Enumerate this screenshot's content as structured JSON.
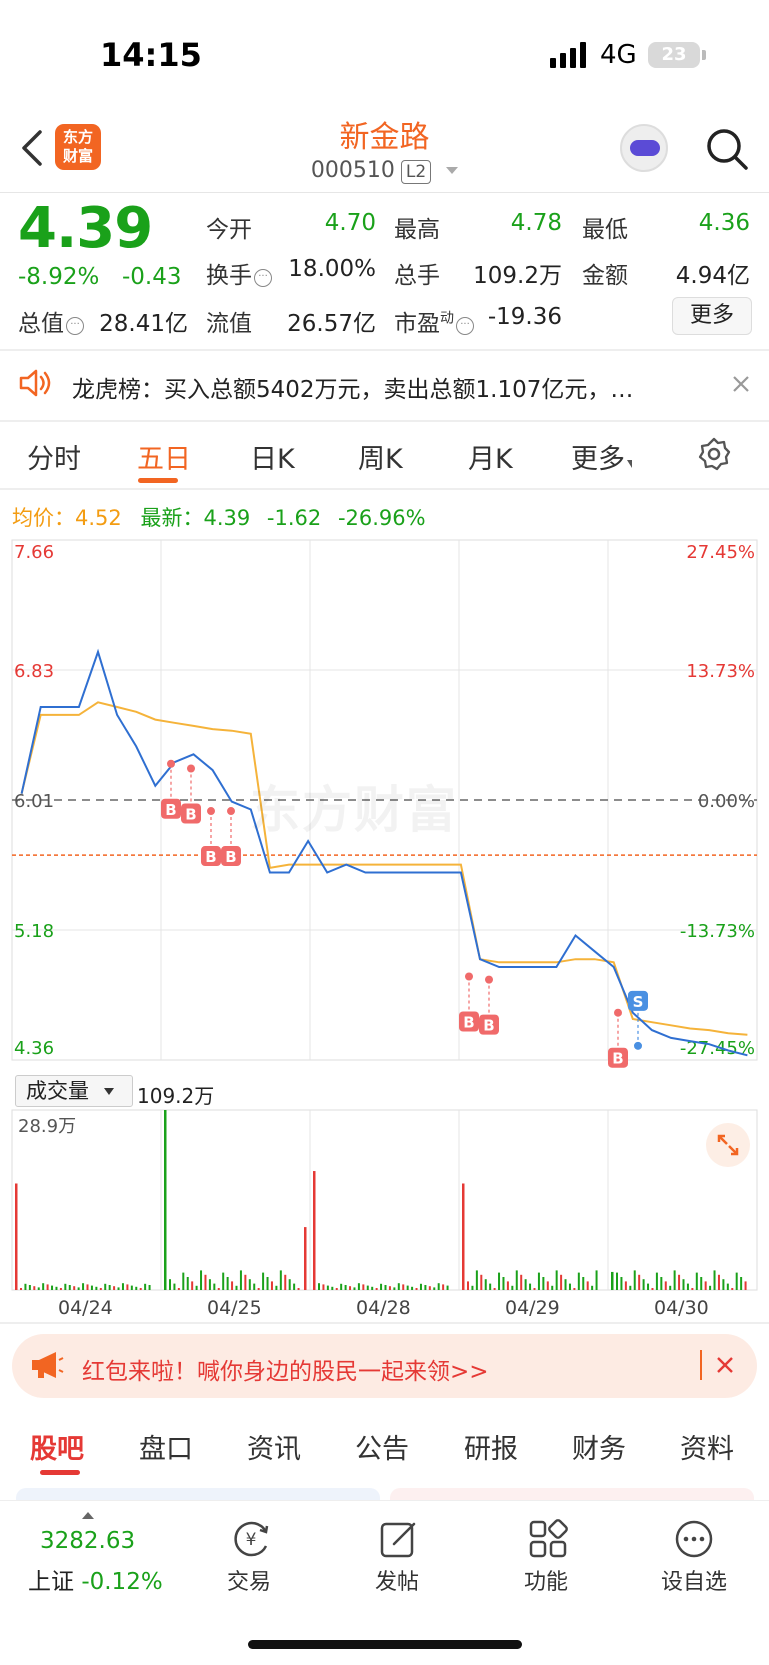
{
  "status_bar": {
    "time": "14:15",
    "network": "4G",
    "battery": "23"
  },
  "header": {
    "logo_line1": "东方",
    "logo_line2": "财富",
    "title": "新金路",
    "code": "000510",
    "level": "L2",
    "robot_icon": "robot-assistant-icon",
    "search_icon": "search-icon"
  },
  "quote": {
    "price": "4.39",
    "change_pct": "-8.92%",
    "change": "-0.43",
    "open_label": "今开",
    "open": "4.70",
    "high_label": "最高",
    "high": "4.78",
    "low_label": "最低",
    "low": "4.36",
    "turnover_label": "换手",
    "turnover": "18.00%",
    "volume_label": "总手",
    "volume": "109.2万",
    "amount_label": "金额",
    "amount": "4.94亿",
    "total_mv_label": "总值",
    "total_mv": "28.41亿",
    "float_mv_label": "流值",
    "float_mv": "26.57亿",
    "pe_label": "市盈",
    "pe_sup": "动",
    "pe": "-19.36",
    "more_label": "更多"
  },
  "news": {
    "text": "龙虎榜：买入总额5402万元，卖出总额1.107亿元，…"
  },
  "chart_tabs": [
    "分时",
    "五日",
    "日K",
    "周K",
    "月K",
    "更多"
  ],
  "chart_tab_active": 1,
  "summary": {
    "avg_label": "均价：",
    "avg_value": "4.52",
    "latest_label": "最新：",
    "latest_value": "4.39",
    "latest_change": "-1.62",
    "latest_pct": "-26.96%"
  },
  "volume_panel": {
    "label": "成交量",
    "total": "109.2万",
    "max": "28.9万"
  },
  "colors": {
    "up": "#e53935",
    "down": "#1aa11a",
    "price_line": "#2f6fd1",
    "avg_line": "#f5b33a",
    "brand": "#f26522"
  },
  "chart_data": {
    "type": "line",
    "x_labels": [
      "04/24",
      "04/25",
      "04/28",
      "04/29",
      "04/30"
    ],
    "y_left": [
      "7.66",
      "6.83",
      "6.01",
      "5.18",
      "4.36"
    ],
    "y_right": [
      "27.45%",
      "13.73%",
      "0.00%",
      "-13.73%",
      "-27.45%"
    ],
    "ylim": [
      4.36,
      7.66
    ],
    "prev_close": 6.01,
    "marker_line": 5.66,
    "series": [
      {
        "name": "均价",
        "values": [
          6.05,
          6.55,
          6.55,
          6.55,
          6.63,
          6.6,
          6.57,
          6.52,
          6.5,
          6.48,
          6.46,
          6.45,
          6.43,
          5.58,
          5.6,
          5.6,
          5.6,
          5.6,
          5.6,
          5.6,
          5.6,
          5.6,
          5.6,
          5.6,
          5.0,
          4.98,
          4.98,
          4.98,
          4.98,
          5.0,
          5.0,
          4.98,
          4.62,
          4.6,
          4.58,
          4.56,
          4.55,
          4.53,
          4.52
        ]
      },
      {
        "name": "最新",
        "values": [
          6.05,
          6.6,
          6.6,
          6.6,
          6.95,
          6.55,
          6.35,
          6.1,
          6.25,
          6.3,
          6.2,
          6.0,
          5.95,
          5.55,
          5.55,
          5.75,
          5.55,
          5.6,
          5.55,
          5.55,
          5.55,
          5.55,
          5.55,
          5.55,
          5.0,
          4.95,
          4.95,
          4.95,
          4.95,
          5.15,
          5.05,
          4.95,
          4.66,
          4.55,
          4.5,
          4.48,
          4.46,
          4.42,
          4.39
        ]
      }
    ],
    "trade_markers": [
      {
        "label": "B",
        "day": "04/25",
        "price": 6.24
      },
      {
        "label": "B",
        "day": "04/25",
        "price": 6.21
      },
      {
        "label": "B",
        "day": "04/25",
        "price": 5.94
      },
      {
        "label": "B",
        "day": "04/25",
        "price": 5.94
      },
      {
        "label": "B",
        "day": "04/29",
        "price": 4.89
      },
      {
        "label": "B",
        "day": "04/29",
        "price": 4.87
      },
      {
        "label": "B",
        "day": "04/30",
        "price": 4.66
      },
      {
        "label": "S",
        "day": "04/30",
        "price": 4.45
      }
    ],
    "volume": {
      "max_label": "28.9万",
      "spikes": [
        {
          "day": "04/24",
          "value": 17.1,
          "color": "red"
        },
        {
          "day": "04/25",
          "value": 28.9,
          "color": "green"
        },
        {
          "day": "04/25",
          "value": 10.1,
          "color": "red"
        },
        {
          "day": "04/28",
          "value": 19.1,
          "color": "red"
        },
        {
          "day": "04/29",
          "value": 17.1,
          "color": "red"
        },
        {
          "day": "04/30",
          "value": 2.9,
          "color": "green"
        }
      ]
    }
  },
  "banner": {
    "text": "红包来啦！喊你身边的股民一起来领>>"
  },
  "sub_tabs": [
    "股吧",
    "盘口",
    "资讯",
    "公告",
    "研报",
    "财务",
    "资料"
  ],
  "bottom_nav": {
    "index_value": "3282.63",
    "index_name": "上证",
    "index_pct": "-0.12%",
    "items": [
      "交易",
      "发帖",
      "功能",
      "设自选"
    ]
  }
}
